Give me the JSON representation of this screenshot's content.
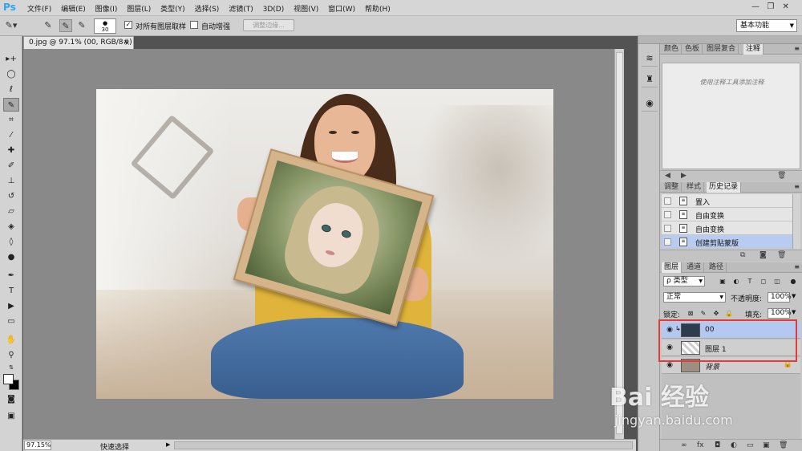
{
  "app": {
    "logo": "Ps"
  },
  "menu": [
    "文件(F)",
    "编辑(E)",
    "图像(I)",
    "图层(L)",
    "类型(Y)",
    "选择(S)",
    "滤镜(T)",
    "3D(D)",
    "视图(V)",
    "窗口(W)",
    "帮助(H)"
  ],
  "window_controls": {
    "minimize": "—",
    "restore": "❐",
    "close": "✕"
  },
  "options": {
    "brush_size": "30",
    "sample_all_layers_label": "对所有图层取样",
    "sample_all_layers_checked": "✓",
    "auto_enhance_label": "自动增强",
    "refine_edge_label": "调整边缘...",
    "workspace": "基本功能"
  },
  "document": {
    "tab_title": "0.jpg @ 97.1% (00, RGB/8#) *",
    "close": "×"
  },
  "status": {
    "zoom": "97.15%",
    "info": "快速选择"
  },
  "notes_panel": {
    "tabs": [
      "颜色",
      "色板",
      "图层复合",
      "注释"
    ],
    "active_tab": 3,
    "empty_text": "使用注释工具添加注释"
  },
  "history_panel": {
    "tabs": [
      "调整",
      "样式",
      "历史记录"
    ],
    "active_tab": 2,
    "items": [
      "置入",
      "自由变换",
      "自由变换",
      "创建剪贴蒙版"
    ],
    "current_index": 3
  },
  "layers_panel": {
    "tabs": [
      "图层",
      "通道",
      "路径"
    ],
    "active_tab": 0,
    "filter_kind": "ρ 类型",
    "blend_mode": "正常",
    "opacity_label": "不透明度:",
    "opacity_value": "100%",
    "lock_label": "锁定:",
    "fill_label": "填充:",
    "fill_value": "100%",
    "layers": [
      {
        "name": "00",
        "selected": true,
        "clipped": true
      },
      {
        "name": "图层 1",
        "selected": false,
        "clipped": false
      },
      {
        "name": "背景",
        "selected": false,
        "clipped": false,
        "locked": true
      }
    ],
    "footer_icons": [
      "∞",
      "fx",
      "◘",
      "◐",
      "▭",
      "▣",
      "🗑"
    ]
  },
  "watermark": {
    "logo": "Bai 经验",
    "url": "jingyan.baidu.com"
  },
  "colors": {
    "selection": "#b5c8f1",
    "highlight": "#e53a3a",
    "ps_blue": "#2fa3f6"
  }
}
